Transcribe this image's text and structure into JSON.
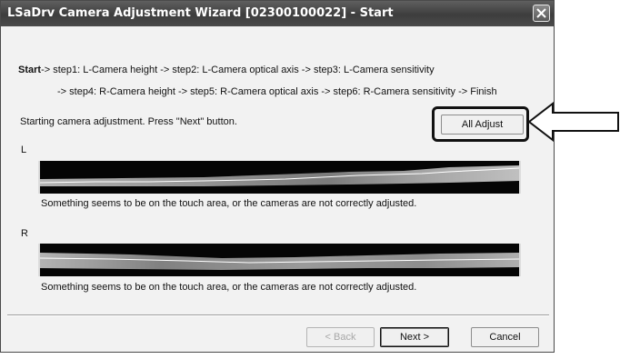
{
  "window": {
    "title": "LSaDrv Camera Adjustment Wizard [02300100022] - Start",
    "close_icon": "close-icon"
  },
  "steps": {
    "line1": {
      "current": "Start",
      "rest": "-> step1: L-Camera height   -> step2: L-Camera optical axis   -> step3: L-Camera sensitivity"
    },
    "line2": "-> step4: R-Camera height  -> step5: R-Camera optical axis   -> step6: R-Camera sensitivity   -> Finish"
  },
  "instruction": "Starting camera adjustment. Press \"Next\" button.",
  "all_adjust_button": "All Adjust",
  "left_panel": {
    "label": "L",
    "status": "Something seems to be on the touch area, or the cameras are not correctly adjusted."
  },
  "right_panel": {
    "label": "R",
    "status": "Something seems to be on the touch area, or the cameras are not correctly adjusted."
  },
  "footer": {
    "back_label": "< Back",
    "next_label": "Next >",
    "cancel_label": "Cancel"
  },
  "annotation": {
    "arrow_icon": "arrow-left-icon"
  }
}
